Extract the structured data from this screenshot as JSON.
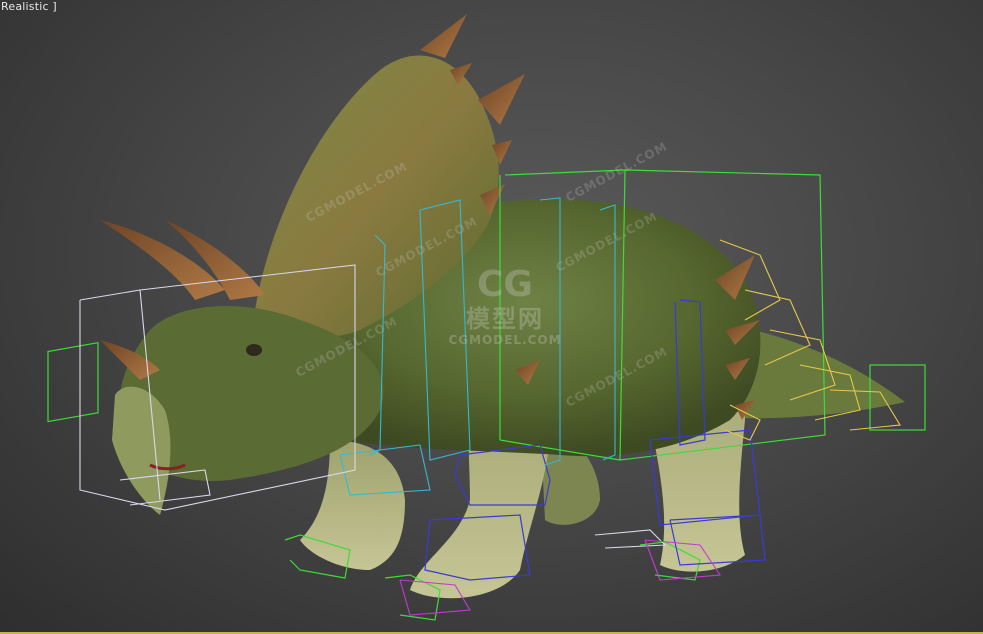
{
  "viewport": {
    "label": "Realistic ]",
    "background": "#474747"
  },
  "watermark": {
    "logo": "CG",
    "title": "模型网",
    "subtitle": "CGMODEL.COM",
    "diagonal_text": "CGMODEL.COM"
  },
  "colors": {
    "skin": "#5d6e3a",
    "belly": "#b9bc8a",
    "horn": "#8a5a32",
    "box_green": "#3ddc3a",
    "box_blue": "#3a3ad6",
    "box_cyan": "#36b8d0",
    "box_yellow": "#e6c84a",
    "box_white": "#d8d8ea",
    "box_magenta": "#c53ad0"
  }
}
